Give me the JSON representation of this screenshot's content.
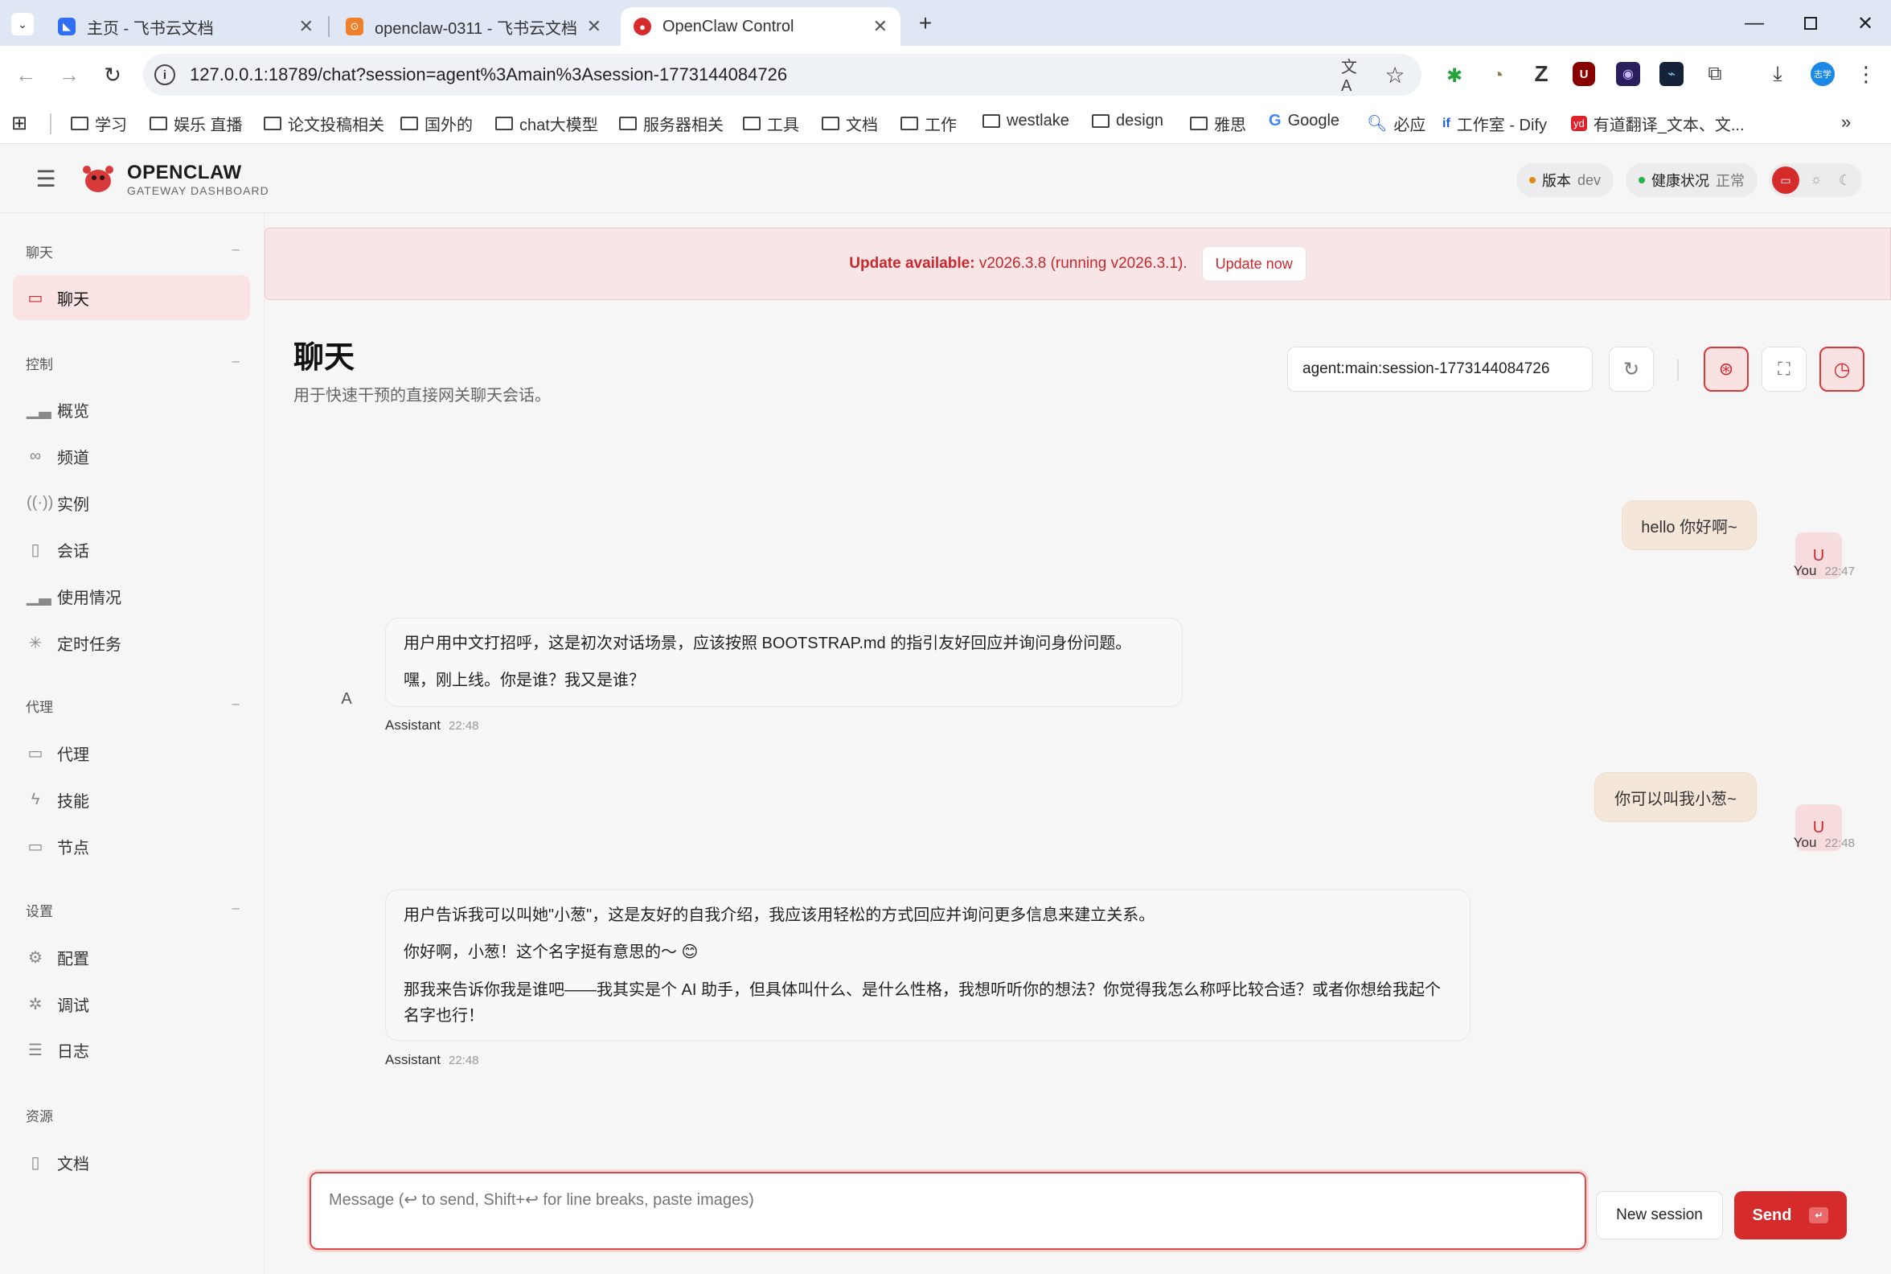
{
  "browser": {
    "tabs": [
      {
        "title": "主页 - 飞书云文档",
        "favicon": "feishu"
      },
      {
        "title": "openclaw-0311 - 飞书云文档",
        "favicon": "feishu-doc"
      },
      {
        "title": "OpenClaw Control",
        "favicon": "openclaw"
      }
    ],
    "url": "127.0.0.1:18789/chat?session=agent%3Amain%3Asession-1773144084726",
    "bookmarks": [
      "学习",
      "娱乐 直播",
      "论文投稿相关",
      "国外的",
      "chat大模型",
      "服务器相关",
      "工具",
      "文档",
      "工作",
      "westlake",
      "design",
      "雅思",
      "Google",
      "必应",
      "工作室 - Dify",
      "有道翻译_文本、文..."
    ],
    "profile_badge": "志学"
  },
  "app": {
    "brand": "OPENCLAW",
    "brand_sub": "GATEWAY DASHBOARD",
    "version_label": "版本",
    "version_value": "dev",
    "health_label": "健康状况",
    "health_value": "正常",
    "accent": "#c8282e"
  },
  "sidebar": {
    "sections": [
      {
        "title": "聊天",
        "items": [
          {
            "label": "聊天",
            "icon": "chat-icon",
            "active": true
          }
        ]
      },
      {
        "title": "控制",
        "items": [
          {
            "label": "概览",
            "icon": "bar-chart-icon"
          },
          {
            "label": "频道",
            "icon": "link-icon"
          },
          {
            "label": "实例",
            "icon": "broadcast-icon"
          },
          {
            "label": "会话",
            "icon": "document-icon"
          },
          {
            "label": "使用情况",
            "icon": "bar-chart-icon"
          },
          {
            "label": "定时任务",
            "icon": "loader-icon"
          }
        ]
      },
      {
        "title": "代理",
        "items": [
          {
            "label": "代理",
            "icon": "folder-icon"
          },
          {
            "label": "技能",
            "icon": "lightning-icon"
          },
          {
            "label": "节点",
            "icon": "monitor-icon"
          }
        ]
      },
      {
        "title": "设置",
        "items": [
          {
            "label": "配置",
            "icon": "gear-icon"
          },
          {
            "label": "调试",
            "icon": "bug-icon"
          },
          {
            "label": "日志",
            "icon": "log-icon"
          }
        ]
      },
      {
        "title": "资源",
        "items": [
          {
            "label": "文档",
            "icon": "book-icon"
          }
        ]
      }
    ]
  },
  "banner": {
    "strong": "Update available:",
    "text": " v2026.3.8 (running v2026.3.1).",
    "button": "Update now"
  },
  "chat": {
    "title": "聊天",
    "subtitle": "用于快速干预的直接网关聊天会话。",
    "session": "agent:main:session-1773144084726",
    "messages": [
      {
        "role": "user",
        "author": "You",
        "time": "22:47",
        "avatar": "U",
        "lines": [
          "hello 你好啊~"
        ]
      },
      {
        "role": "assistant",
        "author": "Assistant",
        "time": "22:48",
        "avatar": "A",
        "lines": [
          "用户用中文打招呼，这是初次对话场景，应该按照 BOOTSTRAP.md 的指引友好回应并询问身份问题。",
          "嘿，刚上线。你是谁？我又是谁？"
        ]
      },
      {
        "role": "user",
        "author": "You",
        "time": "22:48",
        "avatar": "U",
        "lines": [
          "你可以叫我小葱~"
        ]
      },
      {
        "role": "assistant",
        "author": "Assistant",
        "time": "22:48",
        "avatar": "A",
        "lines": [
          "用户告诉我可以叫她\"小葱\"，这是友好的自我介绍，我应该用轻松的方式回应并询问更多信息来建立关系。",
          "你好啊，小葱！这个名字挺有意思的～ 😊",
          "那我来告诉你我是谁吧——我其实是个 AI 助手，但具体叫什么、是什么性格，我想听听你的想法？你觉得我怎么称呼比较合适？或者你想给我起个名字也行！"
        ]
      }
    ],
    "input_placeholder": "Message (↩ to send, Shift+↩ for line breaks, paste images)",
    "new_session": "New session",
    "send": "Send"
  }
}
